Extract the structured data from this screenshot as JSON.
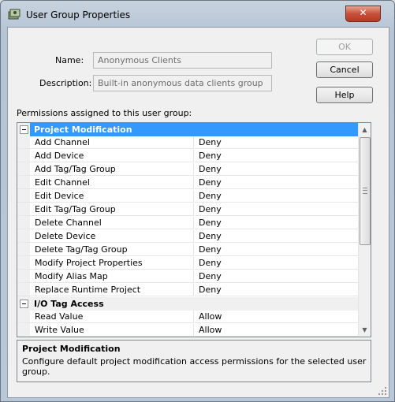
{
  "window": {
    "title": "User Group Properties",
    "close_label": "✕"
  },
  "form": {
    "name_label": "Name:",
    "name_value": "Anonymous Clients",
    "description_label": "Description:",
    "description_value": "Built-in anonymous data clients group",
    "permissions_label": "Permissions assigned to this user group:"
  },
  "buttons": {
    "ok": "OK",
    "cancel": "Cancel",
    "help": "Help"
  },
  "grid": {
    "categories": [
      {
        "name": "Project Modification",
        "selected": true,
        "rows": [
          {
            "permission": "Add Channel",
            "value": "Deny"
          },
          {
            "permission": "Add Device",
            "value": "Deny"
          },
          {
            "permission": "Add Tag/Tag Group",
            "value": "Deny"
          },
          {
            "permission": "Edit Channel",
            "value": "Deny"
          },
          {
            "permission": "Edit Device",
            "value": "Deny"
          },
          {
            "permission": "Edit Tag/Tag Group",
            "value": "Deny"
          },
          {
            "permission": "Delete Channel",
            "value": "Deny"
          },
          {
            "permission": "Delete Device",
            "value": "Deny"
          },
          {
            "permission": "Delete Tag/Tag Group",
            "value": "Deny"
          },
          {
            "permission": "Modify Project Properties",
            "value": "Deny"
          },
          {
            "permission": "Modify Alias Map",
            "value": "Deny"
          },
          {
            "permission": "Replace Runtime Project",
            "value": "Deny"
          }
        ]
      },
      {
        "name": "I/O Tag Access",
        "selected": false,
        "rows": [
          {
            "permission": "Read Value",
            "value": "Allow"
          },
          {
            "permission": "Write Value",
            "value": "Allow"
          }
        ]
      }
    ]
  },
  "description_panel": {
    "title": "Project Modification",
    "text": "Configure default project modification access permissions for the selected user group."
  },
  "icons": {
    "app": "user-group-icon",
    "collapse": "collapse-box-icon",
    "scroll_up": "scroll-up-arrow-icon",
    "scroll_down": "scroll-down-arrow-icon"
  },
  "colors": {
    "selection": "#3399ff",
    "close": "#c6513b"
  }
}
